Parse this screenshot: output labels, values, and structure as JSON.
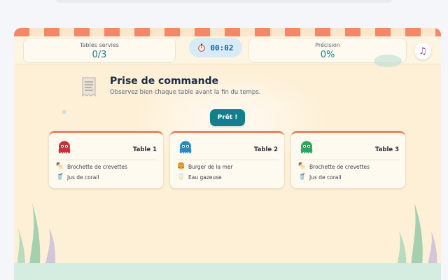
{
  "header": {
    "tables_label": "Tables servies",
    "tables_value": "0/3",
    "timer": "00:02",
    "precision_label": "Précision",
    "precision_value": "0%"
  },
  "icons": {
    "timer": "stopwatch-icon",
    "music": "music-note-icon",
    "intro": "receipt-icon"
  },
  "intro": {
    "title": "Prise de commande",
    "subtitle": "Observez bien chaque table avant la fin du temps."
  },
  "ready_button": "Prêt !",
  "colors": {
    "accent": "#137f8a",
    "awning": "#f28868",
    "card_top": "#ef8060",
    "octopus_red": "#c8303a",
    "octopus_blue": "#2a8bbf",
    "octopus_green": "#2aa860"
  },
  "tables": [
    {
      "label": "Table 1",
      "octopus": "red-octopus-icon",
      "items": [
        {
          "icon": "skewer-icon",
          "name": "Brochette de crevettes"
        },
        {
          "icon": "drink-icon",
          "name": "Jus de corail"
        }
      ]
    },
    {
      "label": "Table 2",
      "octopus": "blue-octopus-icon",
      "items": [
        {
          "icon": "burger-icon",
          "name": "Burger de la mer"
        },
        {
          "icon": "water-glass-icon",
          "name": "Eau gazeuse"
        }
      ]
    },
    {
      "label": "Table 3",
      "octopus": "green-octopus-icon",
      "items": [
        {
          "icon": "skewer-icon",
          "name": "Brochette de crevettes"
        },
        {
          "icon": "drink-icon",
          "name": "Jus de corail"
        }
      ]
    }
  ]
}
